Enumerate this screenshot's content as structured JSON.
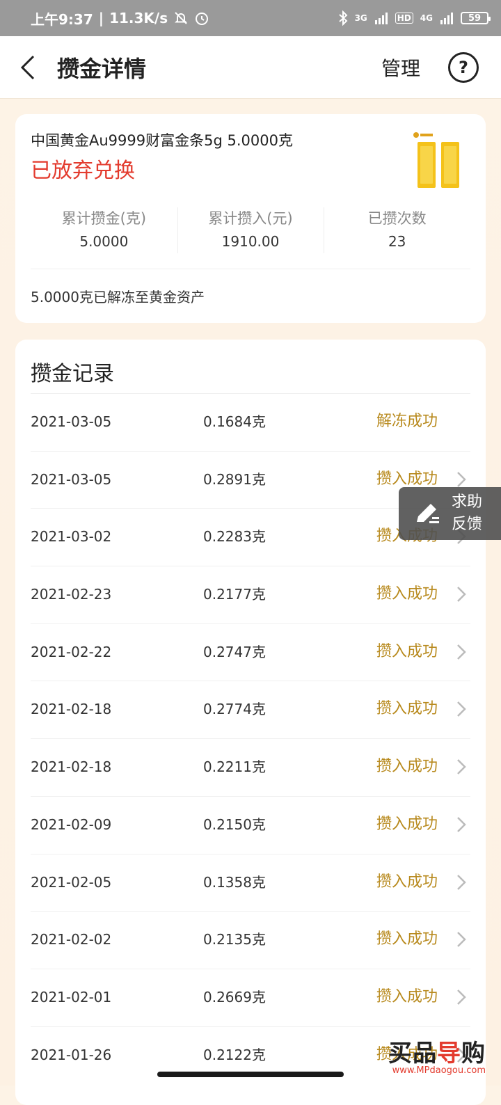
{
  "status_bar": {
    "time": "上午9:37",
    "net_speed": "11.3K/s",
    "network_labels": [
      "3G",
      "HD",
      "4G"
    ],
    "battery": "59"
  },
  "header": {
    "title": "攒金详情",
    "manage_label": "管理",
    "help_label": "?"
  },
  "product": {
    "name": "中国黄金Au9999财富金条5g 5.0000克",
    "status": "已放弃兑换",
    "status_color": "#e33b2e",
    "stats": [
      {
        "label": "累计攒金(克)",
        "value": "5.0000"
      },
      {
        "label": "累计攒入(元)",
        "value": "1910.00"
      },
      {
        "label": "已攒次数",
        "value": "23"
      }
    ],
    "note": "5.0000克已解冻至黄金资产"
  },
  "records": {
    "title": "攒金记录",
    "status_color": "#b88a1e",
    "rows": [
      {
        "date": "2021-03-05",
        "amount": "0.1684克",
        "status": "解冻成功",
        "has_arrow": false
      },
      {
        "date": "2021-03-05",
        "amount": "0.2891克",
        "status": "攒入成功",
        "has_arrow": true
      },
      {
        "date": "2021-03-02",
        "amount": "0.2283克",
        "status": "攒入成功",
        "has_arrow": true
      },
      {
        "date": "2021-02-23",
        "amount": "0.2177克",
        "status": "攒入成功",
        "has_arrow": true
      },
      {
        "date": "2021-02-22",
        "amount": "0.2747克",
        "status": "攒入成功",
        "has_arrow": true
      },
      {
        "date": "2021-02-18",
        "amount": "0.2774克",
        "status": "攒入成功",
        "has_arrow": true
      },
      {
        "date": "2021-02-18",
        "amount": "0.2211克",
        "status": "攒入成功",
        "has_arrow": true
      },
      {
        "date": "2021-02-09",
        "amount": "0.2150克",
        "status": "攒入成功",
        "has_arrow": true
      },
      {
        "date": "2021-02-05",
        "amount": "0.1358克",
        "status": "攒入成功",
        "has_arrow": true
      },
      {
        "date": "2021-02-02",
        "amount": "0.2135克",
        "status": "攒入成功",
        "has_arrow": true
      },
      {
        "date": "2021-02-01",
        "amount": "0.2669克",
        "status": "攒入成功",
        "has_arrow": true
      },
      {
        "date": "2021-01-26",
        "amount": "0.2122克",
        "status": "攒入成功",
        "has_arrow": true
      }
    ]
  },
  "feedback": {
    "label": "求助 反馈"
  },
  "watermark": {
    "text_a": "买品",
    "text_b": "导",
    "text_c": "购",
    "url": "www.MPdaogou.com"
  },
  "colors": {
    "gold": "#b88a1e",
    "red": "#e33b2e",
    "page_bg": "#fdf3e6"
  }
}
